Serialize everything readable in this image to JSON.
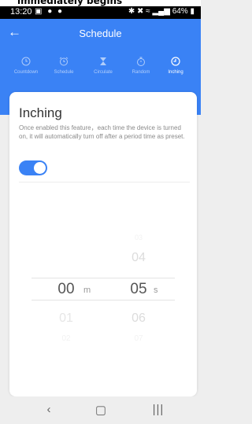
{
  "top_banner": "immediately begins",
  "status_bar": {
    "time": "13:20",
    "battery": "64%"
  },
  "header": {
    "title": "Schedule"
  },
  "tabs": [
    {
      "label": "Countdown",
      "icon": "clock-icon",
      "active": false
    },
    {
      "label": "Schedule",
      "icon": "alarm-clock-icon",
      "active": false
    },
    {
      "label": "Circulate",
      "icon": "hourglass-icon",
      "active": false
    },
    {
      "label": "Random",
      "icon": "stopwatch-icon",
      "active": false
    },
    {
      "label": "Inching",
      "icon": "clock-icon",
      "active": true
    }
  ],
  "inching": {
    "title": "Inching",
    "description": "Once enabled this feature，each time the device is turned on, it will automatically turn off after a period time as preset.",
    "enabled": true
  },
  "picker": {
    "minutes_above": "",
    "minutes_selected": "00",
    "minutes_unit": "m",
    "minutes_below": "01",
    "minutes_below2": "02",
    "seconds_above2": "03",
    "seconds_above": "04",
    "seconds_selected": "05",
    "seconds_unit": "s",
    "seconds_below": "06",
    "seconds_below2": "07"
  },
  "colors": {
    "accent": "#3a82f5",
    "background": "#eeeeee"
  }
}
